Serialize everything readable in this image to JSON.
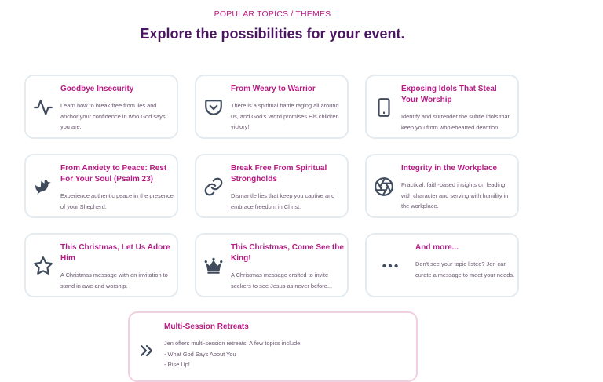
{
  "section": {
    "eyebrow": "POPULAR TOPICS / THEMES",
    "headline": "Explore the possibilities for your event."
  },
  "topics": [
    {
      "title": "Goodbye Insecurity",
      "desc": "Learn how to break free from lies and anchor your confidence in who God says you are.",
      "icon": "heartbeat-icon"
    },
    {
      "title": "From Weary to Warrior",
      "desc": "There is a spiritual battle raging all around us, and God's Word promises His children victory!",
      "icon": "pocket-shield-icon"
    },
    {
      "title": "Exposing Idols That Steal Your Worship",
      "desc": "Identify and surrender the subtle idols that keep you from wholehearted devotion.",
      "icon": "smartphone-icon"
    },
    {
      "title": "From Anxiety to Peace: Rest For Your Soul (Psalm 23)",
      "desc": "Experience authentic peace in the presence of your Shepherd.",
      "icon": "dove-icon"
    },
    {
      "title": "Break Free From Spiritual Strongholds",
      "desc": "Dismantle lies that keep you captive and embrace freedom in Christ.",
      "icon": "chain-link-icon"
    },
    {
      "title": "Integrity in the Workplace",
      "desc": "Practical, faith-based insights on leading with character and serving with humility in the workplace.",
      "icon": "aperture-icon"
    },
    {
      "title": "This Christmas, Let Us Adore Him",
      "desc": "A Christmas message with an invitation to stand in awe and worship.",
      "icon": "star-icon"
    },
    {
      "title": "This Christmas, Come See the King!",
      "desc": "A Christmas message crafted to invite seekers to see Jesus as never before...",
      "icon": "crown-icon"
    },
    {
      "title": "And more...",
      "desc": "Don't see your topic listed? Jen can curate a message to meet your needs.",
      "icon": "more-dots-icon"
    }
  ],
  "retreat": {
    "title": "Multi-Session Retreats",
    "intro": "Jen offers multi-session retreats. A few topics include:",
    "items": [
      "- What God Says About You",
      "- Rise Up!"
    ],
    "icon": "double-chevron-right-icon"
  },
  "colors": {
    "accent": "#b81a83",
    "heading": "#4a1660",
    "icon": "#404c5e",
    "border": "#e3ebf0"
  }
}
